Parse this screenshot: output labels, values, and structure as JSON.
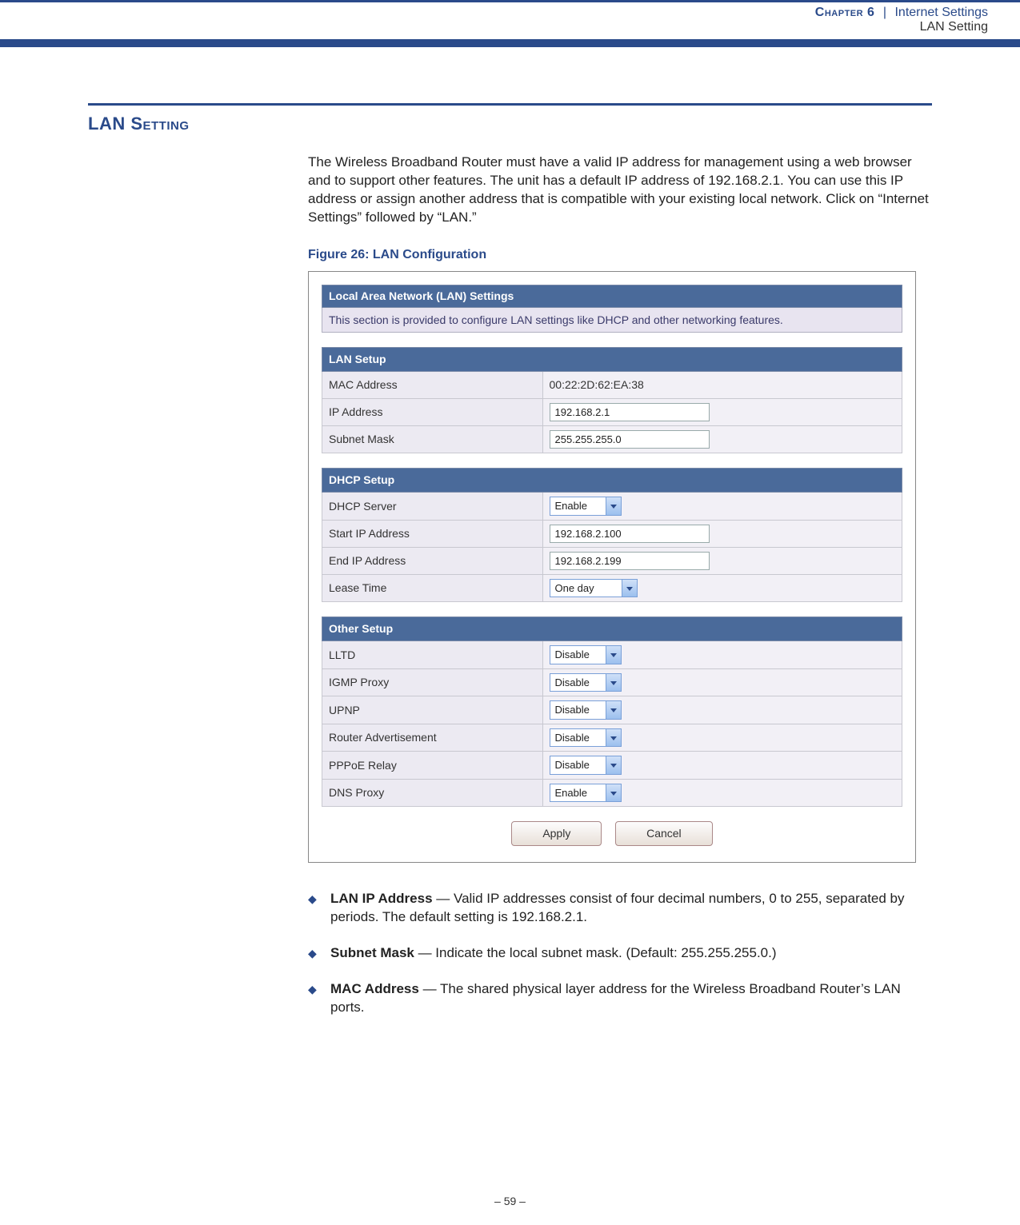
{
  "header": {
    "chapter": "Chapter 6",
    "separator": "|",
    "category": "Internet Settings",
    "subtitle": "LAN Setting"
  },
  "section": {
    "title": "LAN Setting",
    "intro": "The Wireless Broadband Router must have a valid IP address for management using a web browser and to support other features. The unit has a default IP address of 192.168.2.1. You can use this IP address or assign another address that is compatible with your existing local network. Click on “Internet Settings” followed by “LAN.”",
    "figure_caption": "Figure 26:  LAN Configuration"
  },
  "panel": {
    "title": "Local Area Network (LAN) Settings",
    "desc": "This section is provided to configure LAN settings like DHCP and other networking features."
  },
  "lan_setup": {
    "header": "LAN Setup",
    "mac_label": "MAC Address",
    "mac_value": "00:22:2D:62:EA:38",
    "ip_label": "IP Address",
    "ip_value": "192.168.2.1",
    "subnet_label": "Subnet Mask",
    "subnet_value": "255.255.255.0"
  },
  "dhcp_setup": {
    "header": "DHCP Setup",
    "server_label": "DHCP Server",
    "server_value": "Enable",
    "start_label": "Start IP Address",
    "start_value": "192.168.2.100",
    "end_label": "End IP Address",
    "end_value": "192.168.2.199",
    "lease_label": "Lease Time",
    "lease_value": "One day"
  },
  "other_setup": {
    "header": "Other Setup",
    "lltd_label": "LLTD",
    "lltd_value": "Disable",
    "igmp_label": "IGMP Proxy",
    "igmp_value": "Disable",
    "upnp_label": "UPNP",
    "upnp_value": "Disable",
    "ra_label": "Router Advertisement",
    "ra_value": "Disable",
    "pppoe_label": "PPPoE Relay",
    "pppoe_value": "Disable",
    "dns_label": "DNS Proxy",
    "dns_value": "Enable"
  },
  "buttons": {
    "apply": "Apply",
    "cancel": "Cancel"
  },
  "bullets": {
    "b1_label": "LAN IP Address",
    "b1_text": " — Valid IP addresses consist of four decimal numbers, 0 to 255, separated by periods. The default setting is 192.168.2.1.",
    "b2_label": "Subnet Mask",
    "b2_text": " — Indicate the local subnet mask. (Default: 255.255.255.0.)",
    "b3_label": "MAC Address",
    "b3_text": " — The shared physical layer address for the Wireless Broadband Router’s LAN ports."
  },
  "footer": {
    "page": "–  59  –"
  }
}
